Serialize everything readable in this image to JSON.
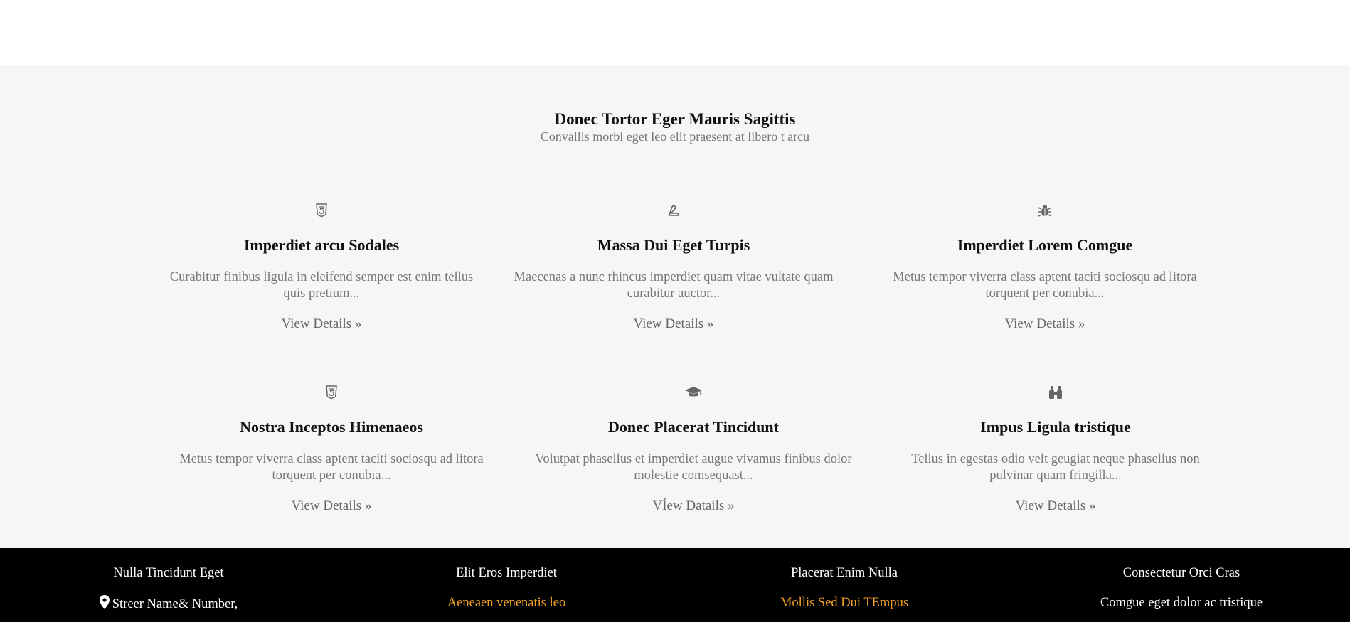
{
  "section": {
    "title": "Donec Tortor Eger Mauris Sagittis",
    "subtitle": "Convallis morbi eget leo elit praesent at libero t arcu"
  },
  "cards": [
    {
      "icon": "html5-icon",
      "title": "Imperdiet arcu Sodales",
      "desc_line1": "Curabitur finibus ligula in eleifend semper est enim tellus",
      "desc_line2": "quis pretium...",
      "link": "View Details »"
    },
    {
      "icon": "pen-nib-icon",
      "title": "Massa Dui Eget Turpis",
      "desc_line1": "Maecenas a nunc rhincus imperdiet quam vitae vultate quam",
      "desc_line2": "curabitur auctor...",
      "link": "View Details »"
    },
    {
      "icon": "bug-icon",
      "title": "Imperdiet Lorem Comgue",
      "desc_line1": "Metus tempor viverra class aptent taciti sociosqu ad litora",
      "desc_line2": "torquent per conubia...",
      "link": "View Details »"
    },
    {
      "icon": "html5-icon",
      "title": "Nostra Inceptos Himenaeos",
      "desc_line1": "Metus tempor viverra class aptent taciti sociosqu ad litora",
      "desc_line2": "torquent per conubia...",
      "link": "View Details »"
    },
    {
      "icon": "graduation-cap-icon",
      "title": "Donec Placerat Tincidunt",
      "desc_line1": "Volutpat phasellus et imperdiet augue vivamus finibus dolor",
      "desc_line2": "molestie comsequast...",
      "link": "VÍew Datails »"
    },
    {
      "icon": "binoculars-icon",
      "title": "Impus Ligula tristique",
      "desc_line1": "Tellus in egestas odio velt geugiat neque phasellus non",
      "desc_line2": "pulvinar quam fringilla...",
      "link": "View Details »"
    }
  ],
  "footer": {
    "columns": [
      {
        "heading": "Nulla Tincidunt Eget",
        "item": "Streer Name& Number,",
        "item_icon": "map-marker-icon",
        "item_color": "#ffffff"
      },
      {
        "heading": "Elit Eros Imperdiet",
        "item": "Aeneaen venenatis leo",
        "item_color": "#f0a028"
      },
      {
        "heading": "Placerat Enim Nulla",
        "item": "Mollis Sed Dui TEmpus",
        "item_color": "#f0a028"
      },
      {
        "heading": "Consectetur Orci Cras",
        "item": "Comgue eget dolor ac tristique",
        "item_color": "#ffffff"
      }
    ]
  }
}
